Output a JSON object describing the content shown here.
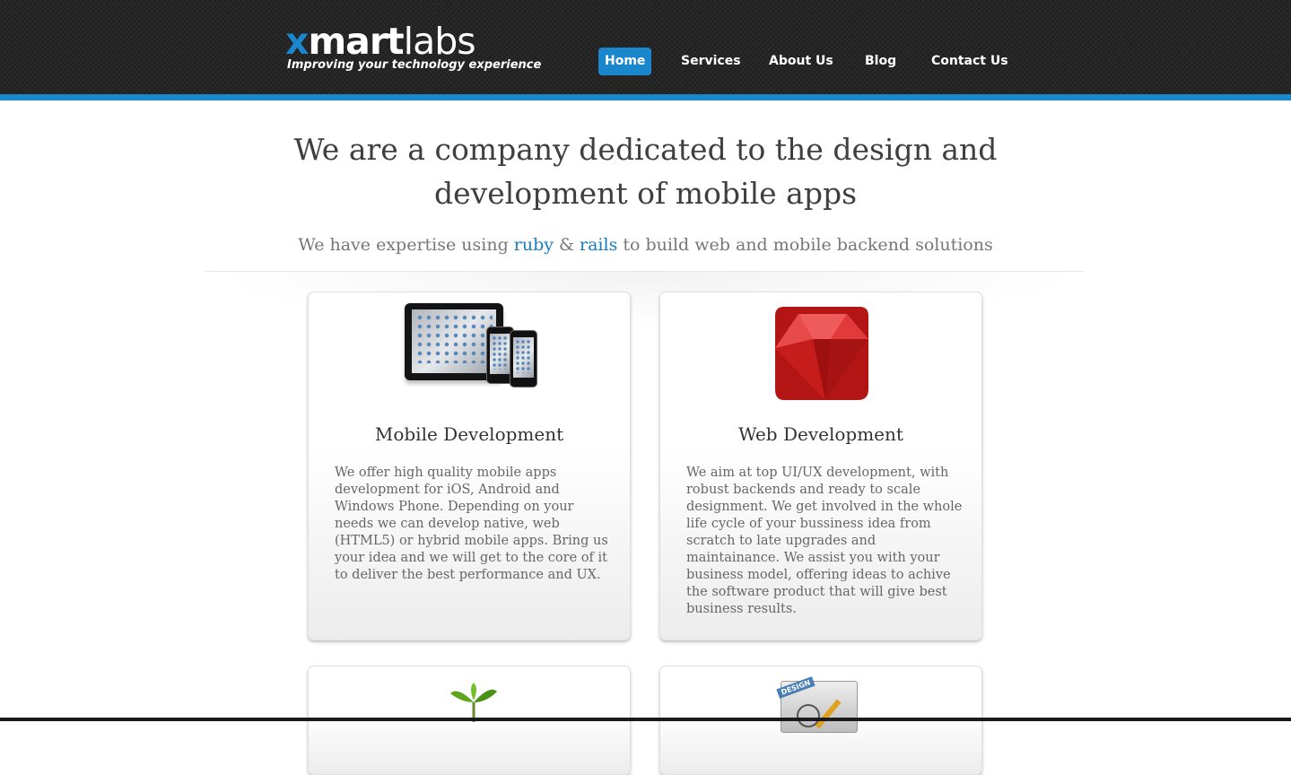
{
  "header": {
    "logo": {
      "x": "x",
      "mart": "mart",
      "labs": "labs"
    },
    "tagline": "Improving your technology experience",
    "nav": [
      {
        "label": "Home",
        "active": true
      },
      {
        "label": "Services"
      },
      {
        "label": "About Us"
      },
      {
        "label": "Blog"
      },
      {
        "label": "Contact Us"
      }
    ]
  },
  "hero": {
    "title_line1": "We are a company dedicated to the design and",
    "title_line2": "development of mobile apps",
    "subtitle_pre": "We have expertise using ",
    "link_ruby": "ruby",
    "amp": " & ",
    "link_rails": "rails",
    "subtitle_post": " to build web and mobile backend solutions"
  },
  "services": [
    {
      "title": "Mobile Development",
      "icon": "mobile-devices-icon",
      "text": "We offer high quality mobile apps development for iOS, Android and Windows Phone. Depending on your needs we can develop native, web (HTML5) or hybrid mobile apps. Bring us your idea and we will get to the core of it to deliver the best performance and UX."
    },
    {
      "title": "Web Development",
      "icon": "ruby-gem-icon",
      "text": "We aim at top UI/UX development, with robust backends and ready to scale designment. We get involved in the whole life cycle of your bussiness idea from scratch to late upgrades and maintainance. We assist you with your business model, offering ideas to achive the software product that will give best business results."
    },
    {
      "icon": "plant-sprout-icon"
    },
    {
      "icon": "design-tools-icon",
      "badge": "DESIGN"
    }
  ],
  "colors": {
    "accent": "#1a87cc",
    "header_bg": "#262626",
    "ruby": "#c01818"
  }
}
